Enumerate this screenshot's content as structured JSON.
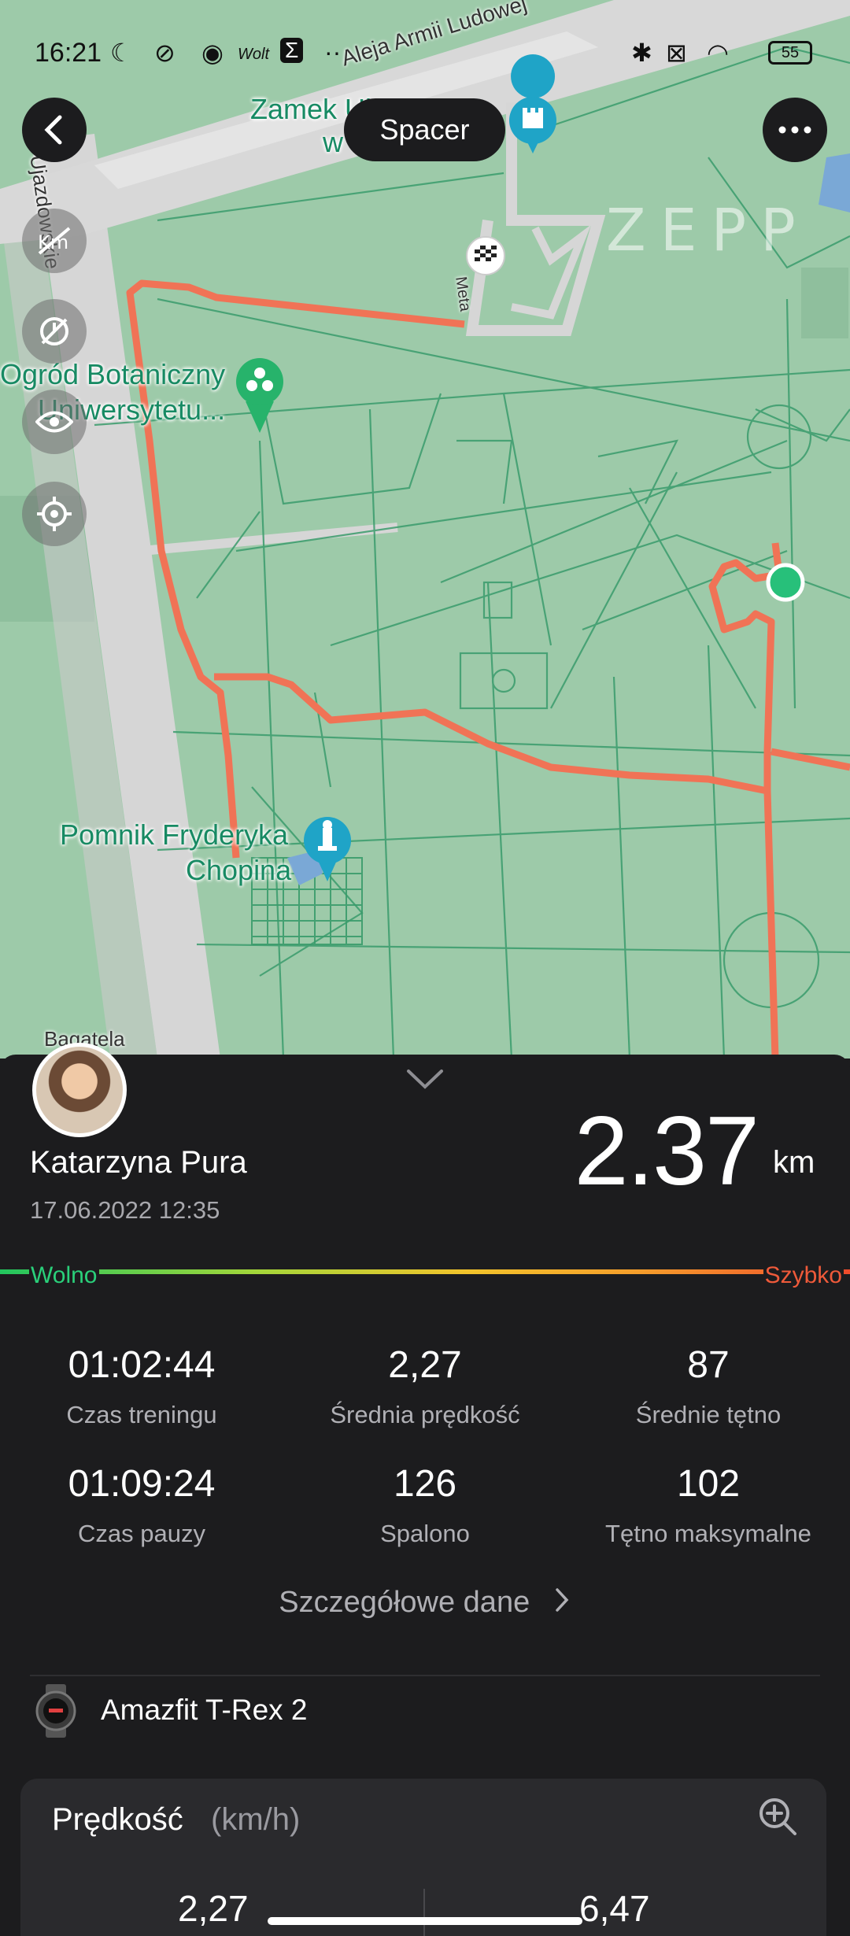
{
  "status_bar": {
    "time": "16:21",
    "battery": "55",
    "left_icons": [
      "moon-icon",
      "dnd-icon",
      "messenger-icon",
      "wolt-icon",
      "sigma-icon",
      "more-dots-icon"
    ],
    "right_icons": [
      "bluetooth-icon",
      "no-sim-icon",
      "wifi-icon",
      "battery-icon"
    ]
  },
  "map": {
    "title": "Spacer",
    "watermark": "ZEPP",
    "labels": {
      "castle": "Zamek Ujazdowski",
      "castle_line1": "Zamek Uj",
      "castle_line2": "w",
      "botanic_line1": "Ogród Botaniczny",
      "botanic_line2": "Uniwersytetu...",
      "chopin_line1": "Pomnik Fryderyka",
      "chopin_line2": "Chopina",
      "street_armii": "Aleja Armii Ludowej",
      "street_ujazdowskie": "Ujazdowskie",
      "bagatela": "Bagatela",
      "start_flag_text": "Meta"
    },
    "route_color": "#f07356",
    "start_marker_color": "#27c07a"
  },
  "summary": {
    "user_name": "Katarzyna Pura",
    "date": "17.06.2022 12:35",
    "distance": "2.37",
    "distance_unit": "km",
    "pace_slow": "Wolno",
    "pace_fast": "Szybko"
  },
  "stats": [
    {
      "value": "01:02:44",
      "label": "Czas treningu"
    },
    {
      "value": "2,27",
      "label": "Średnia prędkość"
    },
    {
      "value": "87",
      "label": "Średnie tętno"
    },
    {
      "value": "01:09:24",
      "label": "Czas pauzy"
    },
    {
      "value": "126",
      "label": "Spalono"
    },
    {
      "value": "102",
      "label": "Tętno maksymalne"
    }
  ],
  "details_link": "Szczegółowe dane",
  "device": {
    "name": "Amazfit T-Rex 2"
  },
  "speed_card": {
    "title": "Prędkość",
    "unit": "(km/h)",
    "peek_left": "2,27",
    "peek_right": "6,47"
  },
  "colors": {
    "sheet_bg": "#1c1c1e",
    "slow": "#2ad07a",
    "fast": "#ef5a3a"
  }
}
